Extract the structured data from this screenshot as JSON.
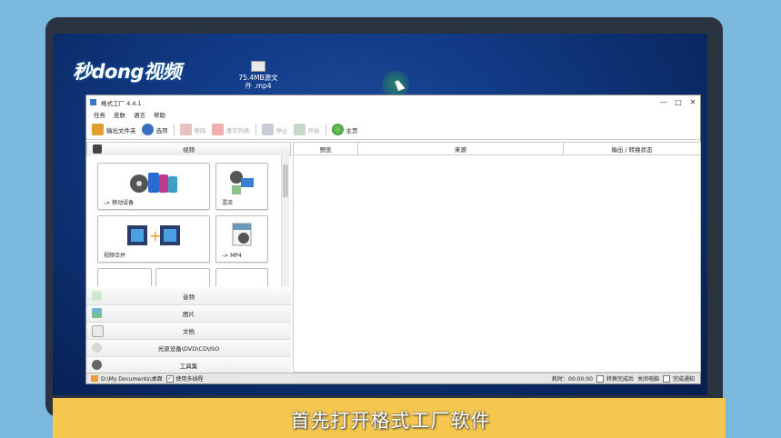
{
  "logo": {
    "text": "秒dong视频"
  },
  "desktop_icon": {
    "label": "75.4MB源文件 .mp4"
  },
  "window": {
    "title": "格式工厂 4.4.1",
    "controls": {
      "minimize": "—",
      "maximize": "□",
      "close": "✕"
    },
    "menu": [
      "任务",
      "皮肤",
      "语言",
      "帮助"
    ],
    "toolbar": {
      "output_folder": "输出文件夹",
      "options": "选项",
      "remove": "移除",
      "clear_list": "清空列表",
      "stop": "停止",
      "start": "开始",
      "home": "主页"
    },
    "video_section": {
      "label": "视频"
    },
    "tiles": [
      {
        "label": "-> 移动设备"
      },
      {
        "label": "混流"
      },
      {
        "label": "视频合并"
      },
      {
        "label": "-> MP4"
      }
    ],
    "categories": [
      "音频",
      "图片",
      "文档",
      "光驱设备\\DVD\\CD\\ISO",
      "工具集"
    ],
    "table_headers": [
      "预览",
      "来源",
      "输出 / 转换状态"
    ],
    "status": {
      "path": "D:\\My Documents\\桌面",
      "multithread": "使用多线程",
      "elapsed_label": "耗时：00:00:00",
      "after_convert": "转换完成后",
      "shutdown": "关闭电脑",
      "notify": "完成通知"
    }
  },
  "subtitle": "首先打开格式工厂软件",
  "colors": {
    "banner": "#f5c74f",
    "desktop": "#123a85",
    "background": "#7ab8de"
  }
}
